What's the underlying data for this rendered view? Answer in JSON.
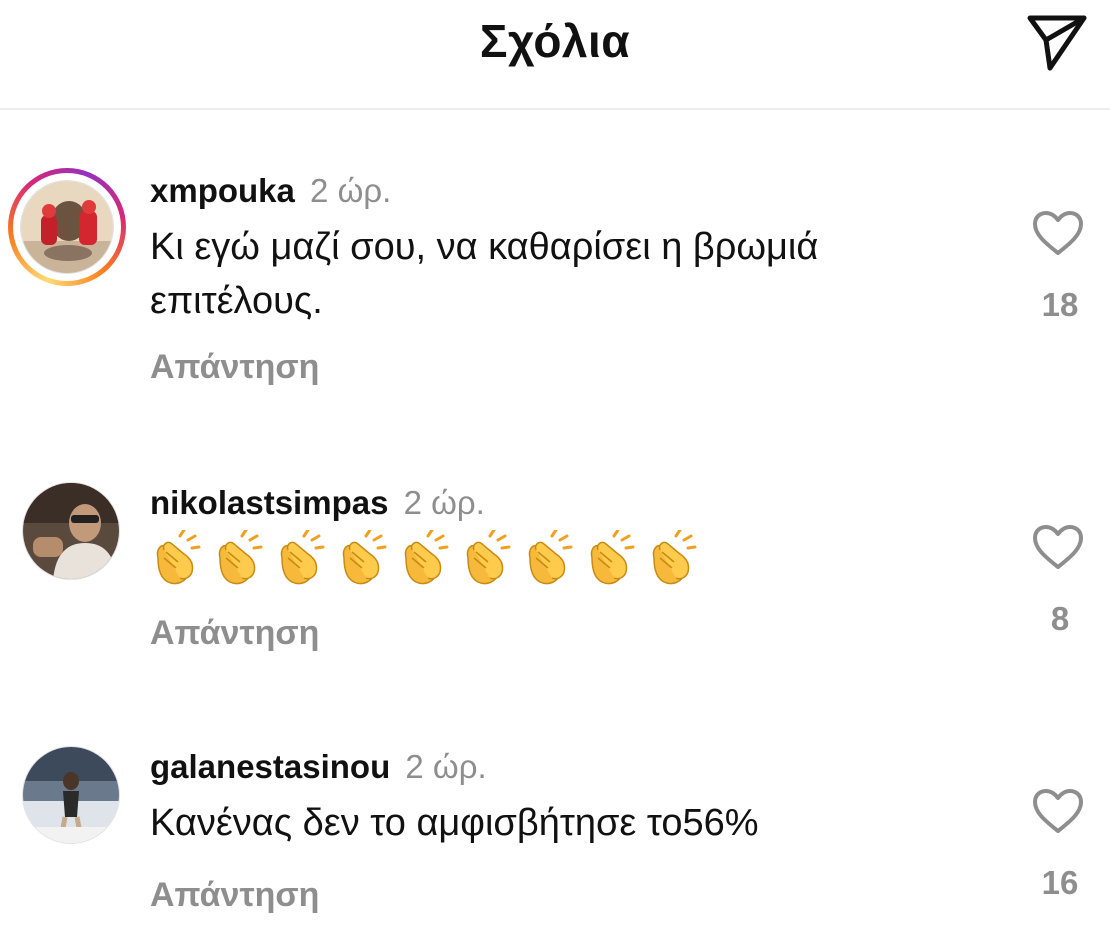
{
  "header": {
    "title": "Σχόλια",
    "send_icon": "paper-plane-icon"
  },
  "comments": [
    {
      "username": "xmpouka",
      "time": "2 ώρ.",
      "text": "Κι εγώ μαζί σου, να καθαρίσει η βρωμιά επιτέλους.",
      "reply_label": "Απάντηση",
      "likes": "18",
      "has_story_ring": true
    },
    {
      "username": "nikolastsimpas",
      "time": "2 ώρ.",
      "text": "👏👏👏👏👏👏👏👏👏",
      "reply_label": "Απάντηση",
      "likes": "8",
      "has_story_ring": false
    },
    {
      "username": "galanestasinou",
      "time": "2 ώρ.",
      "text": "Κανένας δεν το αμφισβήτησε το56%",
      "reply_label": "Απάντηση",
      "likes": "16",
      "has_story_ring": false
    }
  ],
  "colors": {
    "secondary_text": "#8e8e8e",
    "story_ring": [
      "#feda75",
      "#fa7e1e",
      "#d62976",
      "#962fbf"
    ]
  }
}
